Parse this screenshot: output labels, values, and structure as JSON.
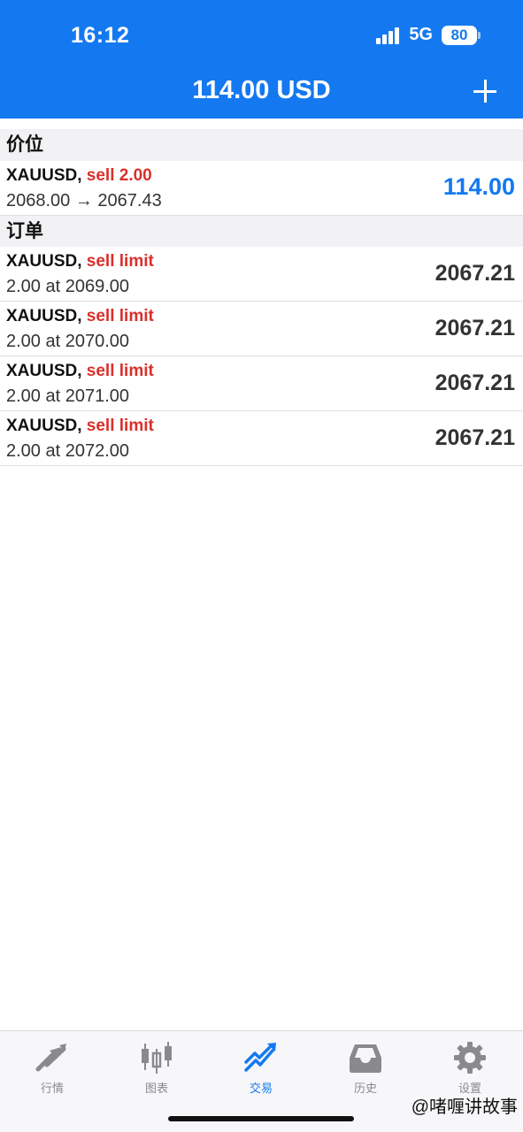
{
  "status_bar": {
    "time": "16:12",
    "network": "5G",
    "battery": "80"
  },
  "nav": {
    "title": "114.00 USD",
    "add_icon": "plus-icon"
  },
  "cut_off_text": "",
  "positions_section": {
    "title": "价位",
    "rows": [
      {
        "symbol": "XAUUSD,",
        "action": "sell 2.00",
        "detail": "2068.00 → 2067.43",
        "value": "114.00"
      }
    ]
  },
  "orders_section": {
    "title": "订单",
    "rows": [
      {
        "symbol": "XAUUSD,",
        "action": "sell limit",
        "detail": "2.00 at 2069.00",
        "value": "2067.21"
      },
      {
        "symbol": "XAUUSD,",
        "action": "sell limit",
        "detail": "2.00 at 2070.00",
        "value": "2067.21"
      },
      {
        "symbol": "XAUUSD,",
        "action": "sell limit",
        "detail": "2.00 at 2071.00",
        "value": "2067.21"
      },
      {
        "symbol": "XAUUSD,",
        "action": "sell limit",
        "detail": "2.00 at 2072.00",
        "value": "2067.21"
      }
    ]
  },
  "tabs": [
    {
      "label": "行情",
      "icon": "quotes-arrows-icon",
      "active": false
    },
    {
      "label": "图表",
      "icon": "candlestick-chart-icon",
      "active": false
    },
    {
      "label": "交易",
      "icon": "trade-trend-icon",
      "active": true
    },
    {
      "label": "历史",
      "icon": "history-inbox-icon",
      "active": false
    },
    {
      "label": "设置",
      "icon": "settings-gear-icon",
      "active": false
    }
  ],
  "watermark": "@啫喱讲故事",
  "colors": {
    "brand": "#1479f0",
    "sell": "#d8302b",
    "profit": "#1479f0",
    "inactive": "#8a8a8e"
  }
}
